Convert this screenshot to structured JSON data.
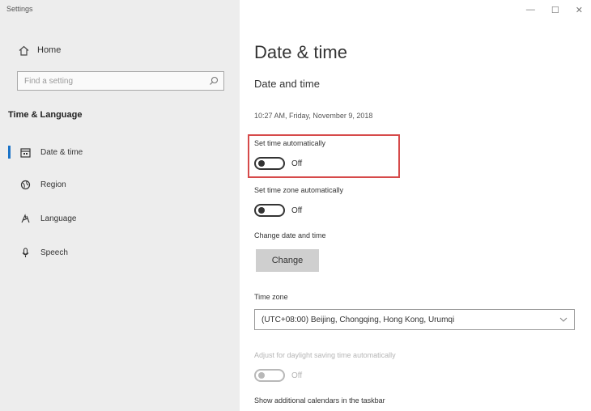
{
  "window": {
    "title": "Settings",
    "controls": {
      "minimize": "—",
      "maximize": "☐",
      "close": "✕"
    }
  },
  "sidebar": {
    "home_label": "Home",
    "search_placeholder": "Find a setting",
    "section_header": "Time & Language",
    "items": [
      {
        "label": "Date & time",
        "icon": "calendar-icon",
        "active": true
      },
      {
        "label": "Region",
        "icon": "globe-icon",
        "active": false
      },
      {
        "label": "Language",
        "icon": "language-icon",
        "active": false
      },
      {
        "label": "Speech",
        "icon": "microphone-icon",
        "active": false
      }
    ]
  },
  "main": {
    "title": "Date & time",
    "subtitle": "Date and time",
    "current_datetime": "10:27 AM, Friday, November 9, 2018",
    "set_time_auto": {
      "label": "Set time automatically",
      "state": "Off"
    },
    "set_tz_auto": {
      "label": "Set time zone automatically",
      "state": "Off"
    },
    "change_datetime": {
      "label": "Change date and time",
      "button": "Change"
    },
    "time_zone": {
      "label": "Time zone",
      "value": "(UTC+08:00) Beijing, Chongqing, Hong Kong, Urumqi"
    },
    "dst": {
      "label": "Adjust for daylight saving time automatically",
      "state": "Off"
    },
    "additional_calendars": {
      "label": "Show additional calendars in the taskbar"
    }
  },
  "colors": {
    "accent": "#1a73c8",
    "highlight": "#d64a4a",
    "sidebar_bg": "#ededed"
  }
}
